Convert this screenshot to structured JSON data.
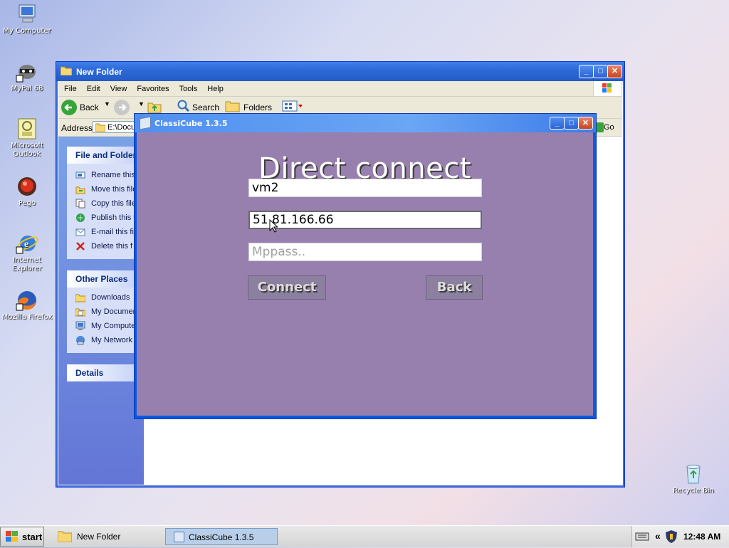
{
  "desktop": {
    "icons": [
      {
        "label": "My Computer",
        "icon": "computer-icon"
      },
      {
        "label": "MyPal 68",
        "icon": "mypal-icon"
      },
      {
        "label": "Microsoft Outlook",
        "icon": "outlook-icon"
      },
      {
        "label": "Pego",
        "icon": "pego-icon"
      },
      {
        "label": "Internet Explorer",
        "icon": "ie-icon"
      },
      {
        "label": "Mozilla Firefox",
        "icon": "firefox-icon"
      },
      {
        "label": "Recycle Bin",
        "icon": "recycle-bin-icon"
      }
    ]
  },
  "explorer": {
    "title": "New Folder",
    "menu": [
      "File",
      "Edit",
      "View",
      "Favorites",
      "Tools",
      "Help"
    ],
    "toolbar": {
      "back": "Back",
      "search": "Search",
      "folders": "Folders"
    },
    "address": {
      "label": "Address",
      "value": "E:\\Docu",
      "go": "Go"
    },
    "tasks": {
      "header": "File and Folder",
      "items": [
        "Rename this",
        "Move this file",
        "Copy this file",
        "Publish this f",
        "E-mail this fil",
        "Delete this f"
      ]
    },
    "places": {
      "header": "Other Places",
      "items": [
        "Downloads",
        "My Documen",
        "My Compute",
        "My Network"
      ]
    },
    "details": {
      "header": "Details"
    }
  },
  "classicube": {
    "title": "ClassiCube 1.3.5",
    "heading": "Direct connect",
    "username": "vm2",
    "address": "51.81.166.66",
    "mppass_placeholder": "Mppass..",
    "connect": "Connect",
    "back": "Back"
  },
  "taskbar": {
    "start": "start",
    "tasks": [
      "New Folder",
      "ClassiCube 1.3.5"
    ],
    "clock": "12:48 AM",
    "expand": "«"
  },
  "colors": {
    "xp_blue": "#0a58e5",
    "cc_bg": "#9880ae",
    "taskbar": "#d4d4d4"
  }
}
